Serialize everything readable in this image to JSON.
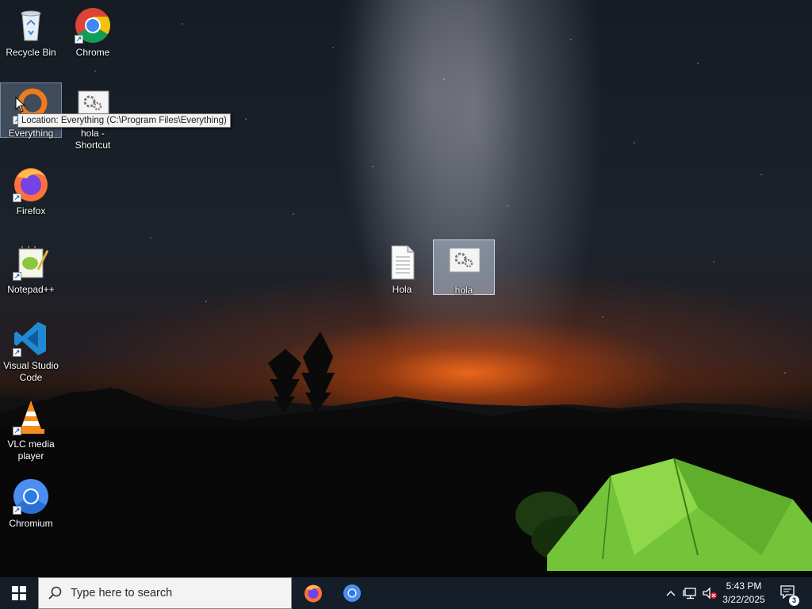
{
  "desktop": {
    "icons": [
      {
        "label": "Recycle Bin"
      },
      {
        "label": "Chrome"
      },
      {
        "label": "Everything"
      },
      {
        "label": "hola - Shortcut"
      },
      {
        "label": "Firefox"
      },
      {
        "label": "Notepad++"
      },
      {
        "label": "Visual Studio Code"
      },
      {
        "label": "VLC media player"
      },
      {
        "label": "Chromium"
      },
      {
        "label": "Hola"
      },
      {
        "label": "hola"
      }
    ],
    "tooltip": "Location: Everything (C:\\Program Files\\Everything)"
  },
  "taskbar": {
    "search_placeholder": "Type here to search",
    "pinned_apps": [
      "firefox-icon",
      "chromium-icon"
    ],
    "clock": {
      "time": "5:43 PM",
      "date": "3/22/2025"
    },
    "notification_count": "3",
    "accent_color": "#151d29"
  }
}
